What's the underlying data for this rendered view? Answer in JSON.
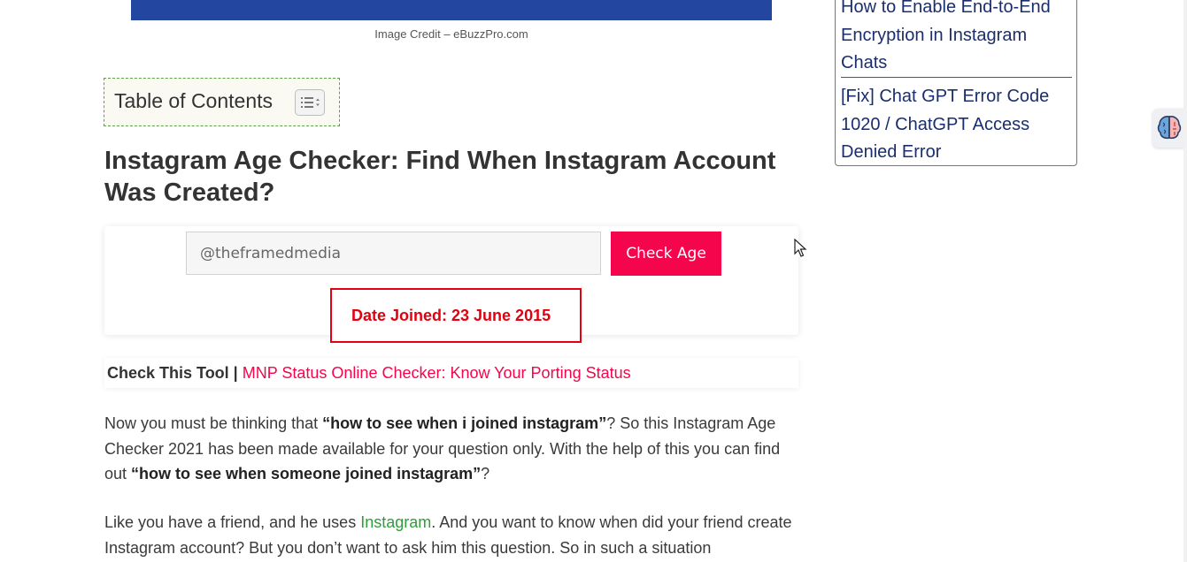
{
  "hero": {
    "image_credit": "Image Credit – eBuzzPro.com",
    "image_color": "#2346a0"
  },
  "toc": {
    "title": "Table of Contents",
    "toggle_icon": "list-toggle-icon"
  },
  "article": {
    "heading": "Instagram Age Checker: Find When Instagram Account Was Created?"
  },
  "tool": {
    "username_value": "@theframedmedia",
    "button_label": "Check Age",
    "result": "Date Joined: 23 June 2015",
    "accent_color": "#f5054b",
    "result_color": "#e3000f"
  },
  "check_tool": {
    "prefix": "Check This Tool | ",
    "link_text": "MNP Status Online Checker: Know Your Porting Status"
  },
  "paragraphs": {
    "p1_a": "Now you must be thinking that ",
    "p1_b": "“how to see when i joined instagram”",
    "p1_c": "? So this Instagram Age Checker 2021 has been made available for your question only. With the help of this you can find out ",
    "p1_d": "“how to see when someone joined instagram”",
    "p1_e": "?",
    "p2_a": "Like you have a friend, and he uses ",
    "p2_link": "Instagram",
    "p2_b": ". And you want to know when did your friend create Instagram account? But you don’t want to ask him this question. So in such a situation"
  },
  "sidebar": {
    "posts": [
      "How to Enable End-to-End Encryption in Instagram Chats",
      "[Fix] Chat GPT Error Code 1020 / ChatGPT Access Denied Error"
    ],
    "link_color": "#1a2e6e"
  },
  "widget": {
    "icon": "brain-icon"
  }
}
